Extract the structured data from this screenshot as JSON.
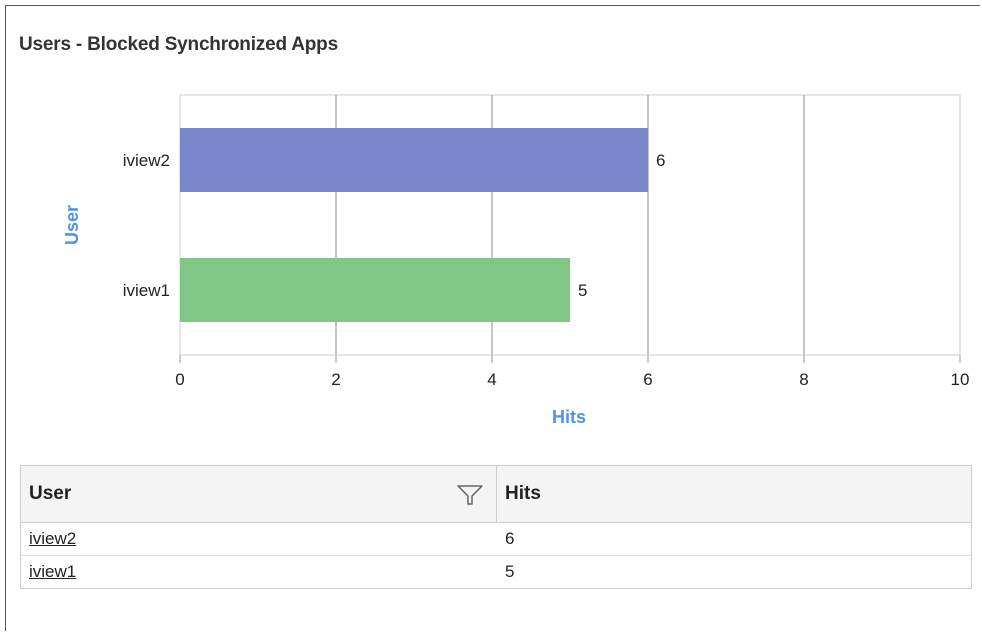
{
  "panel": {
    "title": "Users - Blocked Synchronized Apps"
  },
  "chart_data": {
    "type": "bar",
    "orientation": "horizontal",
    "categories": [
      "iview2",
      "iview1"
    ],
    "values": [
      6,
      5
    ],
    "bar_colors": [
      "#7a86cc",
      "#80c685"
    ],
    "xlabel": "Hits",
    "ylabel": "User",
    "xlim": [
      0,
      10
    ],
    "xticks": [
      0,
      2,
      4,
      6,
      8,
      10
    ],
    "grid": true,
    "axis_title_color": "#4d94e8"
  },
  "table": {
    "headers": {
      "user": "User",
      "hits": "Hits"
    },
    "filter_icon": "funnel-icon",
    "rows": [
      {
        "user": "iview2",
        "hits": "6"
      },
      {
        "user": "iview1",
        "hits": "5"
      }
    ]
  }
}
